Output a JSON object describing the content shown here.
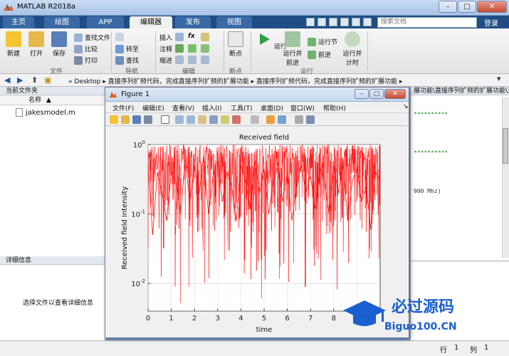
{
  "window": {
    "title": "MATLAB R2018a"
  },
  "tabs": [
    {
      "label": "主页",
      "state": "plain"
    },
    {
      "label": "绘图",
      "state": "plain"
    },
    {
      "label": "APP",
      "state": "plain"
    },
    {
      "label": "编辑器",
      "state": "active"
    },
    {
      "label": "发布",
      "state": "plain"
    },
    {
      "label": "视图",
      "state": "plain"
    }
  ],
  "search": {
    "placeholder": "搜索文档"
  },
  "login_label": "登录",
  "toolstrip": {
    "file": {
      "new": "新建",
      "open": "打开",
      "save": "保存",
      "find_files": "查找文件",
      "compare": "比较",
      "print": "打印",
      "group": "文件"
    },
    "nav": {
      "goto": "转至",
      "find": "查找",
      "group": "导航"
    },
    "edit": {
      "insert": "插入",
      "comment": "注释",
      "indent": "缩进",
      "group": "编辑"
    },
    "breakpoints": {
      "label": "断点",
      "group": "断点"
    },
    "run": {
      "run": "运行",
      "run_advance": "运行并\n前进",
      "run_section": "运行节",
      "advance": "前进",
      "run_time": "运行并\n计时",
      "group": "运行"
    }
  },
  "address": {
    "prefix": "«",
    "path": [
      "Desktop",
      "直接序列扩频代码，完成直接序列扩频的扩展功能",
      "直接序列扩频代码，完成直接序列扩频的扩展功能"
    ]
  },
  "left_panel": {
    "title": "当前文件夹",
    "column": "名称",
    "sort": "▲",
    "files": [
      "jakesmodel.m"
    ],
    "details_title": "详细信息",
    "details_hint": "选择文件以查看详细信息"
  },
  "editor": {
    "tab_title": "展功能\\直接序列扩频的扩展功能\\直...",
    "lines": [
      "**********",
      "**********",
      "900 Mhz)"
    ]
  },
  "status": {
    "row_label": "行",
    "row": "1",
    "col_label": "列",
    "col": "1"
  },
  "figure": {
    "title": "Figure 1",
    "menus": [
      "文件(F)",
      "编辑(E)",
      "查看(V)",
      "插入(I)",
      "工具(T)",
      "桌面(D)",
      "窗口(W)",
      "帮助(H)"
    ]
  },
  "chart_data": {
    "type": "line",
    "title": "Received field",
    "xlabel": "time",
    "ylabel": "Received field intensity",
    "xlim": [
      0,
      10
    ],
    "ylim": [
      0.004,
      1
    ],
    "yscale": "log",
    "xticks": [
      "0",
      "1",
      "2",
      "3",
      "4",
      "5",
      "6",
      "7",
      "8",
      "9"
    ],
    "yticks": [
      "10^0",
      "10^-1",
      "10^-2"
    ],
    "grid": true,
    "series": [
      {
        "color": "#ff0000",
        "x": [
          0,
          0.2,
          0.4,
          0.6,
          0.8,
          1.0,
          1.2,
          1.4,
          1.6,
          1.8,
          2.0,
          2.2,
          2.4,
          2.6,
          2.8,
          3.0,
          3.2,
          3.4,
          3.6,
          3.8,
          4.0,
          4.2,
          4.4,
          4.6,
          4.8,
          5.0,
          5.2,
          5.4,
          5.6,
          5.8,
          6.0,
          6.2,
          6.4,
          6.6,
          6.8,
          7.0,
          7.2,
          7.4,
          7.6,
          7.8,
          8.0,
          8.2,
          8.4,
          8.6,
          8.8,
          9.0,
          9.2,
          9.4,
          9.6,
          9.8,
          10.0
        ],
        "y": [
          0.5,
          0.05,
          0.4,
          0.2,
          0.08,
          0.4,
          0.3,
          0.1,
          0.6,
          0.15,
          0.5,
          0.2,
          0.7,
          0.1,
          0.35,
          0.6,
          0.15,
          0.4,
          0.25,
          0.08,
          0.5,
          0.3,
          0.12,
          0.6,
          0.2,
          0.45,
          0.1,
          0.3,
          0.55,
          0.15,
          0.4,
          0.08,
          0.25,
          0.5,
          0.2,
          0.35,
          0.12,
          0.45,
          0.3,
          0.1,
          0.5,
          0.2,
          0.6,
          0.08,
          0.3,
          0.45,
          0.15,
          0.25,
          0.06,
          0.4,
          0.3
        ]
      }
    ]
  },
  "watermark": {
    "cn": "必过源码",
    "en": "Biguo100.CN"
  }
}
